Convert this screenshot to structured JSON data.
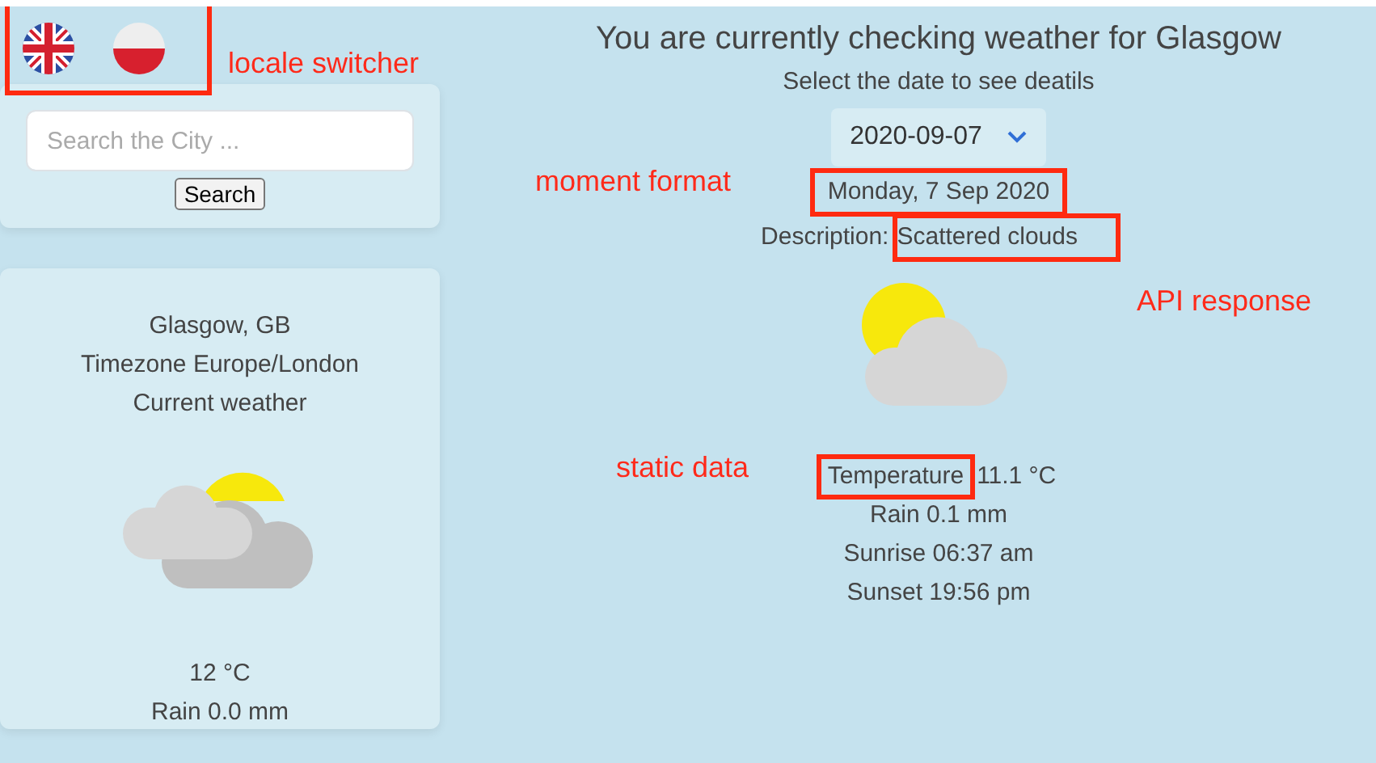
{
  "locale_switcher": {
    "highlighted": true,
    "flags": [
      {
        "kind": "gb"
      },
      {
        "kind": "pl"
      }
    ]
  },
  "search": {
    "placeholder": "Search the City ...",
    "button": "Search"
  },
  "current": {
    "location": "Glasgow, GB",
    "timezone": "Timezone Europe/London",
    "heading": "Current weather",
    "temperature": "12 °C",
    "rain": "Rain 0.0 mm"
  },
  "details": {
    "title": "You are currently checking weather for Glasgow",
    "prompt": "Select the date to see deatils",
    "date_select": "2020-09-07",
    "date": {
      "text": "Monday, 7 Sep 2020",
      "highlighted": true
    },
    "description": {
      "label": "Description:",
      "value": "Scattered clouds",
      "highlighted": true
    },
    "temperature": {
      "label": "Temperature",
      "value": "11.1 °C",
      "highlighted": true
    },
    "lines": [
      "Rain 0.1 mm",
      "Sunrise 06:37 am",
      "Sunset 19:56 pm"
    ]
  },
  "annotations": [
    {
      "text": "locale switcher"
    },
    {
      "text": "moment format"
    },
    {
      "text": "API response"
    },
    {
      "text": "static data"
    }
  ]
}
